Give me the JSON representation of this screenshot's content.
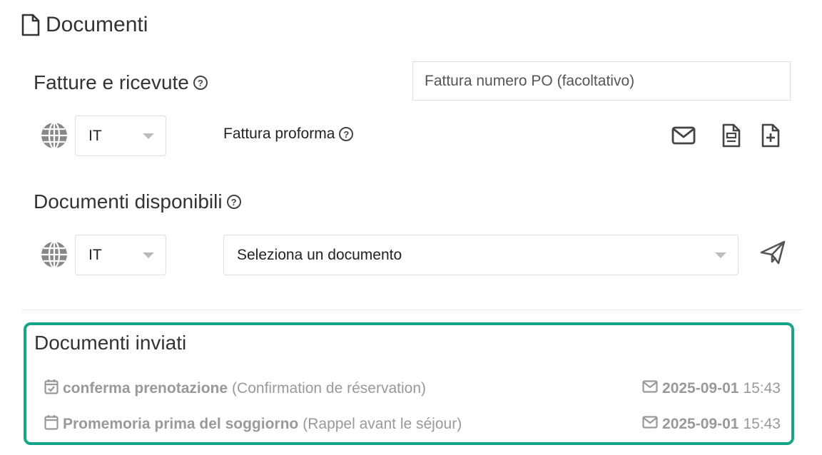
{
  "section": {
    "title": "Documenti"
  },
  "invoices": {
    "heading": "Fatture e ricevute",
    "po_placeholder": "Fattura numero PO (facoltativo)",
    "language": "IT",
    "proforma_label": "Fattura proforma"
  },
  "available": {
    "heading": "Documenti disponibili",
    "language": "IT",
    "document_select": "Seleziona un documento"
  },
  "sent": {
    "heading": "Documenti inviati",
    "items": [
      {
        "name": "conferma prenotazione",
        "translation": "(Confirmation de réservation)",
        "date": "2025-09-01",
        "time": "15:43",
        "icon": "calendar-check-icon"
      },
      {
        "name": "Promemoria prima del soggiorno",
        "translation": "(Rappel avant le séjour)",
        "date": "2025-09-01",
        "time": "15:43",
        "icon": "calendar-icon"
      }
    ]
  },
  "colors": {
    "accent": "#17a589",
    "muted": "#999999"
  }
}
